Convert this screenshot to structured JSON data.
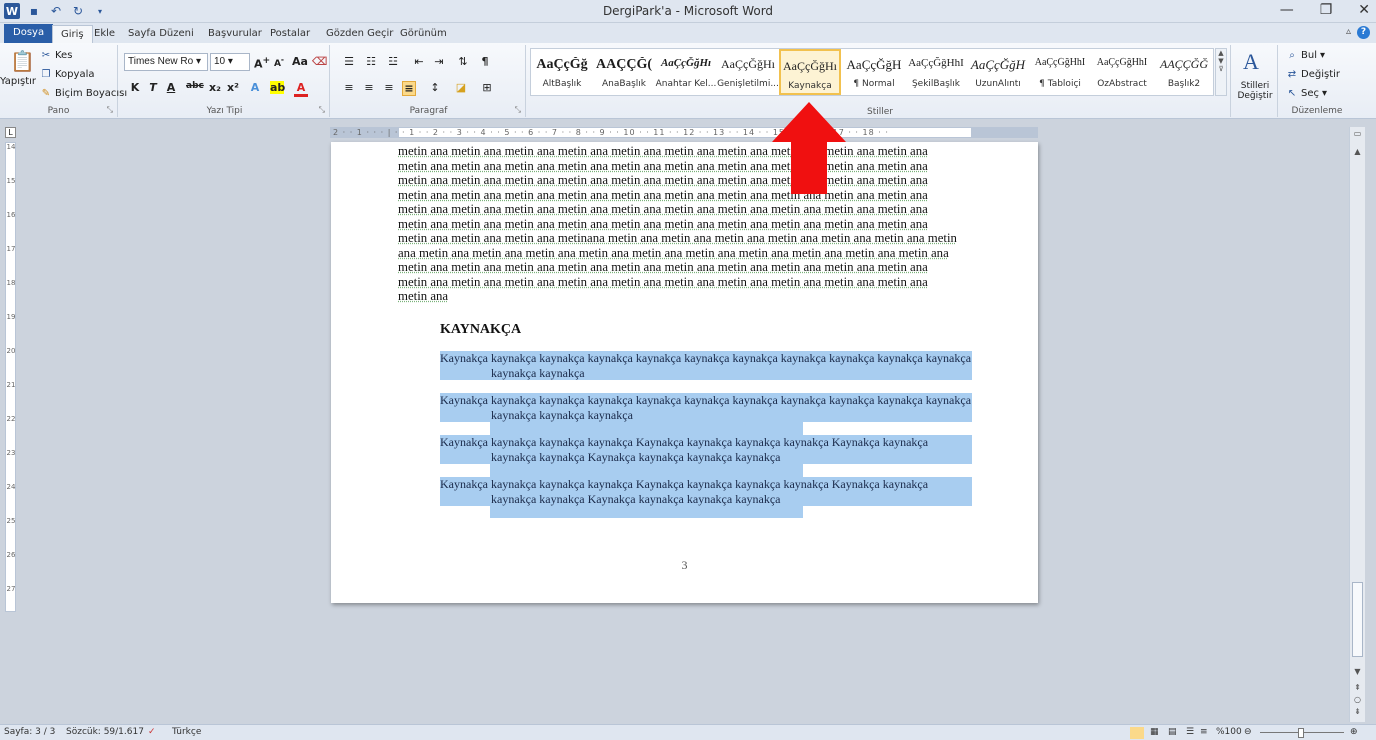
{
  "window": {
    "title": "DergiPark'a - Microsoft Word",
    "minimize": "—",
    "maximize": "❐",
    "close": "✕"
  },
  "tabs": [
    "Dosya",
    "Giriş",
    "Ekle",
    "Sayfa Düzeni",
    "Başvurular",
    "Postalar",
    "Gözden Geçir",
    "Görünüm"
  ],
  "active_tab": "Giriş",
  "ribbon": {
    "clipboard": {
      "paste": "Yapıştır",
      "cut": "Kes",
      "copy": "Kopyala",
      "format_painter": "Biçim Boyacısı",
      "label": "Pano"
    },
    "font": {
      "name": "Times New Ro",
      "size": "10",
      "label": "Yazı Tipi"
    },
    "paragraph": {
      "label": "Paragraf"
    },
    "styles": {
      "label": "Stiller",
      "items": [
        {
          "sample": "AaÇçĞğ",
          "name": "AltBaşlık"
        },
        {
          "sample": "AAÇÇĞ(",
          "name": "AnaBaşlık"
        },
        {
          "sample": "AaÇçĞğHı",
          "name": "Anahtar Kel..."
        },
        {
          "sample": "AaÇçĞğHı",
          "name": "Genişletilmi..."
        },
        {
          "sample": "AaÇçĞğHı",
          "name": "Kaynakça"
        },
        {
          "sample": "AaÇçĞğH",
          "name": "¶ Normal"
        },
        {
          "sample": "AaÇçĞğHhI",
          "name": "ŞekilBaşlık"
        },
        {
          "sample": "AaÇçĞğH",
          "name": "UzunAlıntı"
        },
        {
          "sample": "AaÇçĞğHhI",
          "name": "¶ Tabloiçi"
        },
        {
          "sample": "AaÇçĞğHhI",
          "name": "ÖzAbstract"
        },
        {
          "sample": "AAÇÇĞĞ",
          "name": "Başlık2"
        }
      ],
      "selected_index": 4,
      "change_styles": "Stilleri Değiştir"
    },
    "editing": {
      "find": "Bul",
      "replace": "Değiştir",
      "select": "Seç",
      "label": "Düzenleme"
    }
  },
  "ruler": {
    "marks": "2 · · 1 · · · | · · 1 · · 2 · · 3 · · 4 · · 5 · · 6 · · 7 · · 8 · · 9 · · 10 · · 11 · · 12 · · 13 · · 14 · · 15 · · 16 · · 17 · · 18 · ·"
  },
  "vruler": [
    "14",
    "15",
    "16",
    "17",
    "18",
    "19",
    "20",
    "21",
    "22",
    "23",
    "24",
    "25",
    "26",
    "27"
  ],
  "document": {
    "body_lines": [
      "metin ana metin ana metin ana metin ana metin ana metin ana metin ana metin ana metin ana metin ana",
      "metin ana metin ana metin ana metin ana metin ana metin ana metin ana metin ana metin ana metin ana",
      "metin ana metin ana metin ana metin ana metin ana metin ana metin ana metin ana metin ana metin ana",
      "metin ana metin ana metin ana metin ana metin ana metin ana metin ana metin ana metin ana metin ana",
      "metin ana metin ana metin ana metin ana metin ana metin ana metin ana metin ana metin ana metin ana",
      "metin ana metin ana metin ana metin ana metin ana metin ana metin ana metin ana metin ana metin ana",
      "metin ana metin ana metin ana metinana metin ana metin ana metin ana metin ana metin ana metin ana metin",
      "ana metin ana metin ana metin ana metin ana metin ana metin ana metin ana metin ana metin ana metin ana",
      "metin ana metin ana metin ana metin ana metin ana metin ana metin ana metin ana metin ana metin ana",
      "metin ana metin ana metin ana metin ana metin ana metin ana metin ana metin ana metin ana metin ana",
      "metin ana"
    ],
    "heading": "KAYNAKÇA",
    "references": [
      {
        "l1": "Kaynakça kaynakça kaynakça kaynakça kaynakça kaynakça kaynakça kaynakça kaynakça kaynakça kaynakça",
        "l2": "kaynakça kaynakça"
      },
      {
        "l1": "Kaynakça kaynakça kaynakça kaynakça kaynakça kaynakça kaynakça kaynakça kaynakça kaynakça kaynakça",
        "l2": "kaynakça kaynakça kaynakça"
      },
      {
        "l1": "Kaynakça kaynakça kaynakça kaynakça Kaynakça kaynakça kaynakça kaynakça Kaynakça kaynakça",
        "l2": "kaynakça kaynakça Kaynakça kaynakça kaynakça kaynakça"
      },
      {
        "l1": "Kaynakça kaynakça kaynakça kaynakça Kaynakça kaynakça kaynakça kaynakça Kaynakça kaynakça",
        "l2": "kaynakça kaynakça Kaynakça kaynakça kaynakça kaynakça"
      }
    ],
    "page_number": "3"
  },
  "status": {
    "page": "Sayfa: 3 / 3",
    "words": "Sözcük: 59/1.617",
    "language": "Türkçe",
    "zoom": "%100"
  }
}
